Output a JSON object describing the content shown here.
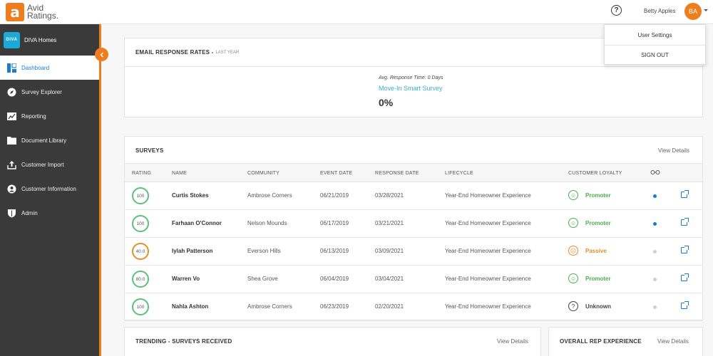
{
  "app": {
    "logo_letter": "a",
    "logo_line1": "Avid",
    "logo_line2": "Ratings."
  },
  "header": {
    "help_icon": "?",
    "user_name": "Betty Apples",
    "avatar_initials": "BA"
  },
  "dropdown": {
    "items": [
      "User Settings",
      "SIGN OUT"
    ]
  },
  "sidebar": {
    "brand_logo": "DIVA",
    "brand_name": "DIVA Homes",
    "items": [
      {
        "label": "Dashboard",
        "icon": "dashboard-icon",
        "active": true
      },
      {
        "label": "Survey Explorer",
        "icon": "compass-icon"
      },
      {
        "label": "Reporting",
        "icon": "chart-icon"
      },
      {
        "label": "Document Library",
        "icon": "folder-icon"
      },
      {
        "label": "Customer Import",
        "icon": "upload-icon"
      },
      {
        "label": "Customer Information",
        "icon": "user-icon"
      },
      {
        "label": "Admin",
        "icon": "shield-icon"
      }
    ]
  },
  "email_card": {
    "title": "EMAIL RESPONSE RATES -",
    "subtitle": "LAST YEAR",
    "avg_response": "Avg. Response Time: 0 Days",
    "survey_name": "Move-In Smart Survey",
    "percent": "0%"
  },
  "surveys": {
    "title": "SURVEYS",
    "view_details": "View Details",
    "columns": [
      "RATING",
      "NAME",
      "COMMUNITY",
      "EVENT DATE",
      "RESPONSE DATE",
      "LIFECYCLE",
      "CUSTOMER LOYALTY"
    ],
    "rows": [
      {
        "rating": "100",
        "name": "Curtis Stokes",
        "community": "Ambrose Corners",
        "event_date": "06/21/2019",
        "response_date": "03/28/2021",
        "lifecycle": "Year-End Homeowner Experience",
        "loyalty": "Promoter",
        "dot": "blue"
      },
      {
        "rating": "100",
        "name": "Farhaan O'Connor",
        "community": "Nelson Mounds",
        "event_date": "06/17/2019",
        "response_date": "03/21/2021",
        "lifecycle": "Year-End Homeowner Experience",
        "loyalty": "Promoter",
        "dot": "blue"
      },
      {
        "rating": "40.0",
        "name": "Iylah Patterson",
        "community": "Everson Hills",
        "event_date": "06/13/2019",
        "response_date": "03/09/2021",
        "lifecycle": "Year-End Homeowner Experience",
        "loyalty": "Passive",
        "dot": "grey"
      },
      {
        "rating": "80.0",
        "name": "Warren Vo",
        "community": "Shea Grove",
        "event_date": "06/04/2019",
        "response_date": "03/04/2021",
        "lifecycle": "Year-End Homeowner Experience",
        "loyalty": "Promoter",
        "dot": "grey"
      },
      {
        "rating": "100",
        "name": "Nahla Ashton",
        "community": "Ambrose Corners",
        "event_date": "06/23/2019",
        "response_date": "02/20/2021",
        "lifecycle": "Year-End Homeowner Experience",
        "loyalty": "Unknown",
        "dot": "grey"
      }
    ]
  },
  "trending": {
    "title": "TRENDING - SURVEYS RECEIVED",
    "view_details": "View Details"
  },
  "rep": {
    "title": "OVERALL REP EXPERIENCE",
    "view_details": "View Details"
  },
  "colors": {
    "brand": "#ee7d1f",
    "active_link": "#1a7bd0",
    "promoter": "#4caf50",
    "passive": "#e88d2a",
    "teal": "#3ab0c8"
  }
}
